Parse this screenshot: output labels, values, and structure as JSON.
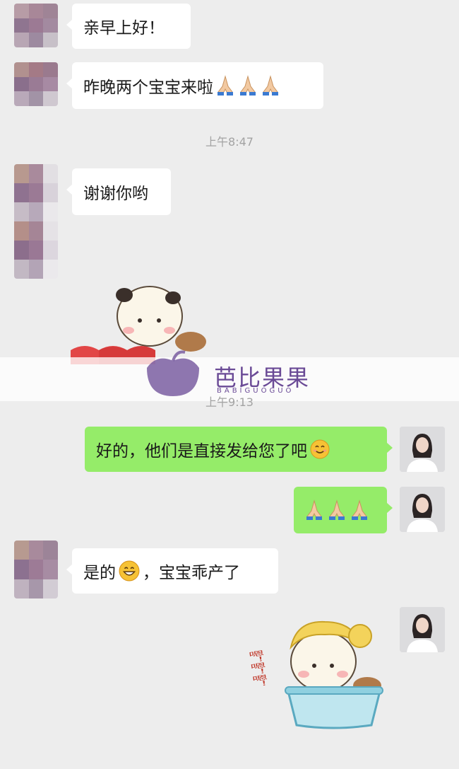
{
  "messages": {
    "m1": {
      "text": "亲早上好！"
    },
    "m2": {
      "text": "昨晚两个宝宝来啦"
    },
    "t1": {
      "text": "上午8:47"
    },
    "m3": {
      "text": "谢谢你哟"
    },
    "t2": {
      "text": "上午9:13"
    },
    "m4": {
      "text": "好的，他们是直接发给您了吧"
    },
    "m6": {
      "text": "是的"
    },
    "m6b": {
      "text": "，宝宝乖产了"
    }
  },
  "sticker_bath": {
    "text": "嗯！嗯！嗯！"
  },
  "watermark": {
    "brand_cn": "芭比果果",
    "brand_en": "BABIGUOGUO"
  },
  "colors": {
    "bg": "#ededed",
    "bubble_incoming": "#ffffff",
    "bubble_outgoing": "#95ec69",
    "timestamp": "#a3a3a3",
    "watermark": "#6a4a96"
  },
  "icons": [
    "pixelated-avatar",
    "user-avatar",
    "praying-hands-emoji",
    "smile-emoji",
    "grin-emoji",
    "panda-sticker",
    "bath-sticker",
    "brand-logo"
  ]
}
